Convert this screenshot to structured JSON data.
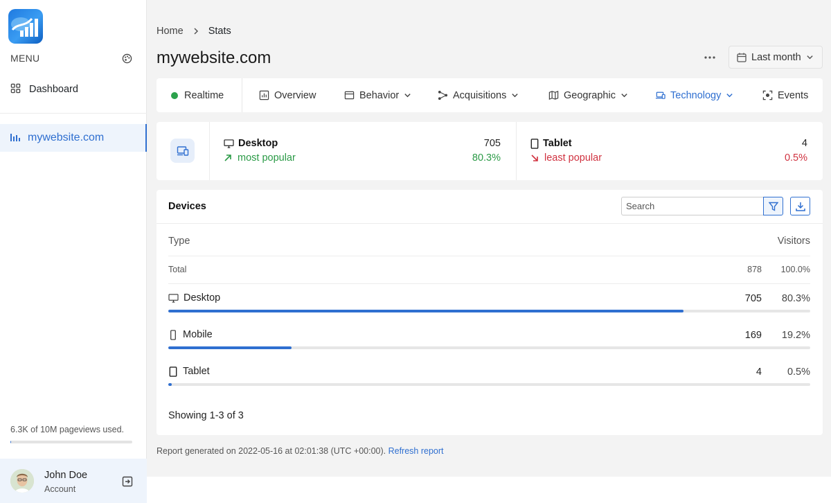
{
  "sidebar": {
    "menu_label": "MENU",
    "items": [
      {
        "label": "Dashboard",
        "icon": "grid-icon"
      },
      {
        "label": "mywebsite.com",
        "icon": "bar-chart-icon"
      }
    ],
    "usage_text": "6.3K of 10M pageviews used.",
    "usage_fraction": 0.00063,
    "user": {
      "name": "John Doe",
      "subtitle": "Account"
    }
  },
  "breadcrumb": {
    "home": "Home",
    "current": "Stats"
  },
  "page_title": "mywebsite.com",
  "period": {
    "label": "Last month"
  },
  "tabs": [
    {
      "label": "Realtime"
    },
    {
      "label": "Overview"
    },
    {
      "label": "Behavior"
    },
    {
      "label": "Acquisitions"
    },
    {
      "label": "Geographic"
    },
    {
      "label": "Technology"
    },
    {
      "label": "Events"
    }
  ],
  "summary": {
    "most": {
      "name": "Desktop",
      "note": "most popular",
      "count": "705",
      "pct": "80.3%"
    },
    "least": {
      "name": "Tablet",
      "note": "least popular",
      "count": "4",
      "pct": "0.5%"
    }
  },
  "devices": {
    "title": "Devices",
    "search_placeholder": "Search",
    "col_type": "Type",
    "col_visitors": "Visitors",
    "total": {
      "label": "Total",
      "count": "878",
      "pct": "100.0%"
    },
    "rows": [
      {
        "name": "Desktop",
        "count": "705",
        "pct": "80.3%",
        "share": 0.803
      },
      {
        "name": "Mobile",
        "count": "169",
        "pct": "19.2%",
        "share": 0.192
      },
      {
        "name": "Tablet",
        "count": "4",
        "pct": "0.5%",
        "share": 0.005
      }
    ],
    "showing": "Showing 1-3 of 3"
  },
  "footer": {
    "report_text": "Report generated on 2022-05-16 at 02:01:38 (UTC +00:00).",
    "refresh_label": "Refresh report"
  },
  "colors": {
    "accent": "#2f6fd0",
    "positive": "#2a9a46",
    "negative": "#d0313f"
  }
}
